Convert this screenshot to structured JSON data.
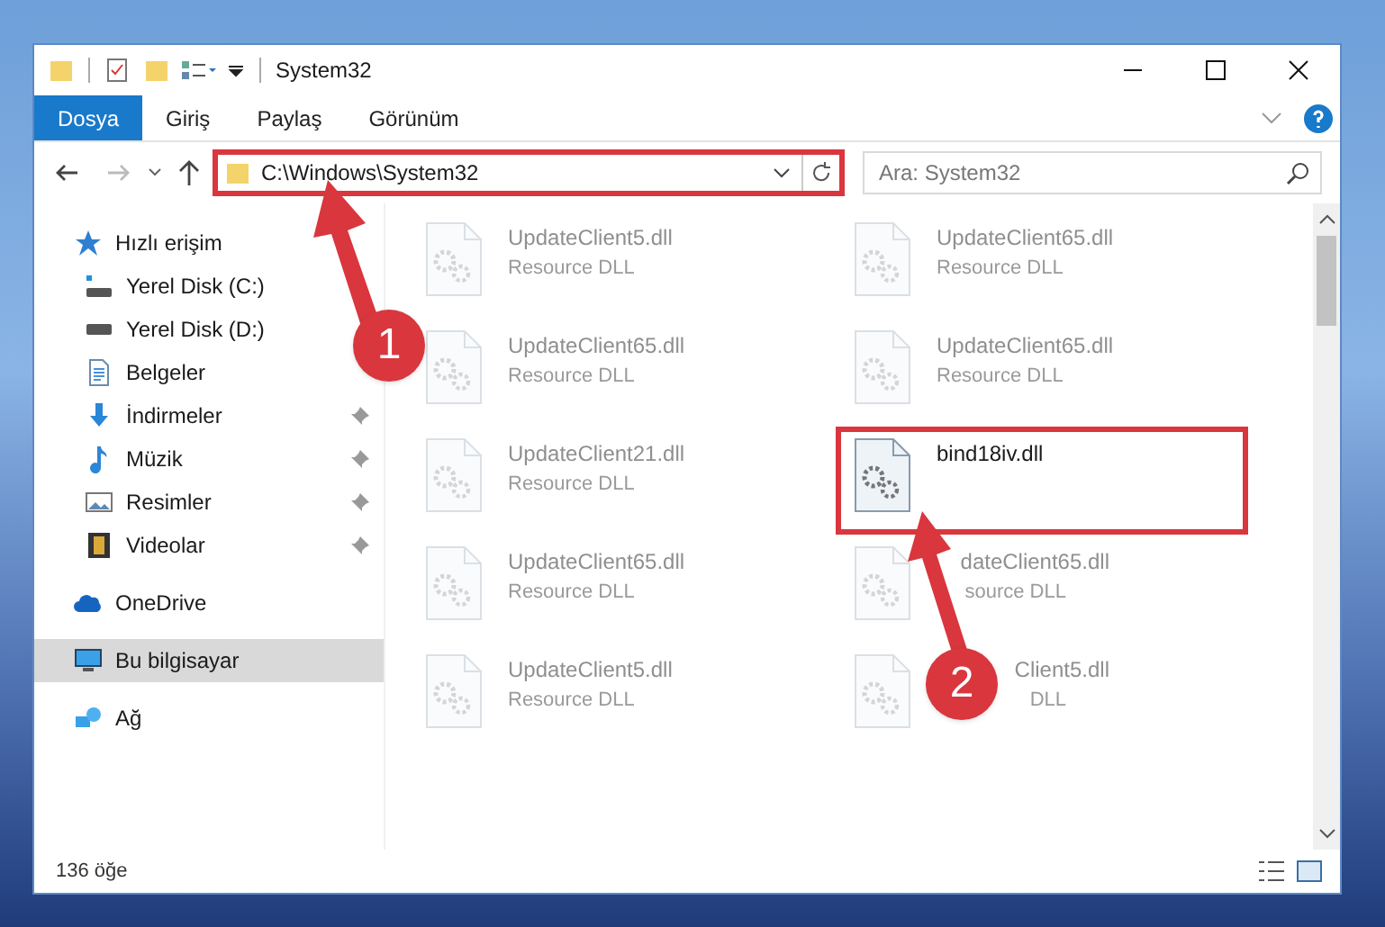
{
  "window": {
    "title": "System32"
  },
  "ribbon_tabs": [
    {
      "label": "Dosya",
      "kind": "file"
    },
    {
      "label": "Giriş",
      "kind": "tab"
    },
    {
      "label": "Paylaş",
      "kind": "tab"
    },
    {
      "label": "Görünüm",
      "kind": "tab"
    }
  ],
  "address_bar": {
    "path": "C:\\Windows\\System32",
    "highlighted": true
  },
  "search": {
    "placeholder": "Ara: System32"
  },
  "navigation": [
    {
      "label": "Hızlı erişim",
      "kind": "star",
      "selected": false,
      "children": [
        {
          "label": "Yerel Disk (C:)",
          "kind": "system-drive",
          "pinned": false,
          "selected": false
        },
        {
          "label": "Yerel Disk (D:)",
          "kind": "drive",
          "pinned": false,
          "selected": false
        },
        {
          "label": "Belgeler",
          "kind": "documents",
          "pinned": false,
          "selected": false
        },
        {
          "label": "İndirmeler",
          "kind": "downloads",
          "pinned": true,
          "selected": false
        },
        {
          "label": "Müzik",
          "kind": "music",
          "pinned": true,
          "selected": false
        },
        {
          "label": "Resimler",
          "kind": "pictures",
          "pinned": true,
          "selected": false
        },
        {
          "label": "Videolar",
          "kind": "videos",
          "pinned": true,
          "selected": false
        }
      ]
    },
    {
      "label": "OneDrive",
      "kind": "cloud",
      "selected": false
    },
    {
      "label": "Bu bilgisayar",
      "kind": "computer",
      "selected": true
    },
    {
      "label": "Ağ",
      "kind": "network",
      "selected": false
    }
  ],
  "files": [
    {
      "name": "UpdateClient5.dll",
      "type": "Resource DLL",
      "faded": true,
      "highlighted": false
    },
    {
      "name": "UpdateClient65.dll",
      "type": "Resource DLL",
      "faded": true,
      "highlighted": false
    },
    {
      "name": "UpdateClient65.dll",
      "type": "Resource DLL",
      "faded": true,
      "highlighted": false
    },
    {
      "name": "UpdateClient65.dll",
      "type": "Resource DLL",
      "faded": true,
      "highlighted": false
    },
    {
      "name": "UpdateClient21.dll",
      "type": "Resource DLL",
      "faded": true,
      "highlighted": false
    },
    {
      "name": "bind18iv.dll",
      "faded": false,
      "highlighted": true
    },
    {
      "name": "UpdateClient65.dll",
      "type": "Resource DLL",
      "faded": true,
      "highlighted": false
    },
    {
      "name": "dateClient65.dll",
      "type": "source DLL",
      "faded": true,
      "highlighted": false,
      "partly_hidden": true
    },
    {
      "name": "UpdateClient5.dll",
      "type": "Resource DLL",
      "faded": true,
      "highlighted": false
    },
    {
      "name": "Client5.dll",
      "type": "DLL",
      "faded": true,
      "highlighted": false,
      "partly_hidden": true
    }
  ],
  "status_bar": {
    "item_count": "136 öğe"
  },
  "steps": [
    {
      "label": "1"
    },
    {
      "label": "2"
    }
  ]
}
